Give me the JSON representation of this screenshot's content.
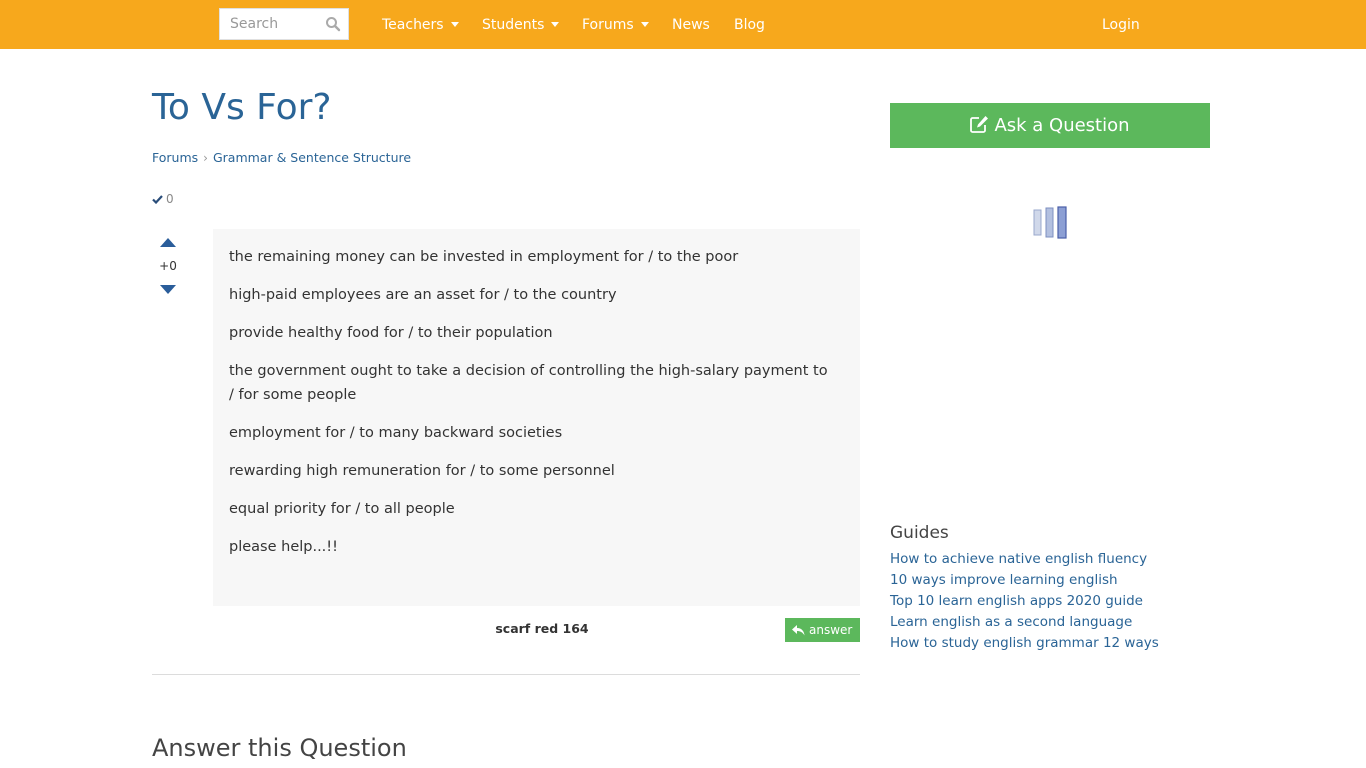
{
  "nav": {
    "search_placeholder": "Search",
    "items": [
      {
        "label": "Teachers",
        "has_dropdown": true
      },
      {
        "label": "Students",
        "has_dropdown": true
      },
      {
        "label": "Forums",
        "has_dropdown": true
      },
      {
        "label": "News",
        "has_dropdown": false
      },
      {
        "label": "Blog",
        "has_dropdown": false
      }
    ],
    "login_label": "Login"
  },
  "question": {
    "title": "To Vs For?",
    "breadcrumb": [
      "Forums",
      "Grammar & Sentence Structure"
    ],
    "accepted_count": "0",
    "vote_count": "+0",
    "body": [
      "the remaining money can be invested in employment for / to the poor",
      "high-paid employees are an asset for / to the country",
      "provide healthy food for / to their population",
      "the government ought to take a decision of controlling the high-salary payment to / for some people",
      "employment for / to many backward societies",
      "rewarding high remuneration for / to some personnel",
      "equal priority for / to all people",
      "please help...!!"
    ],
    "author": "scarf red 164",
    "answer_label": "answer"
  },
  "answer_section": {
    "heading": "Answer this Question"
  },
  "sidebar": {
    "ask_label": "Ask a Question",
    "guides_title": "Guides",
    "guides": [
      "How to achieve native english fluency",
      "10 ways improve learning english",
      "Top 10 learn english apps 2020 guide",
      "Learn english as a second language",
      "How to study english grammar 12 ways"
    ]
  },
  "colors": {
    "topbar": "#f7a81c",
    "link": "#2a6496",
    "green": "#5cb85c"
  }
}
